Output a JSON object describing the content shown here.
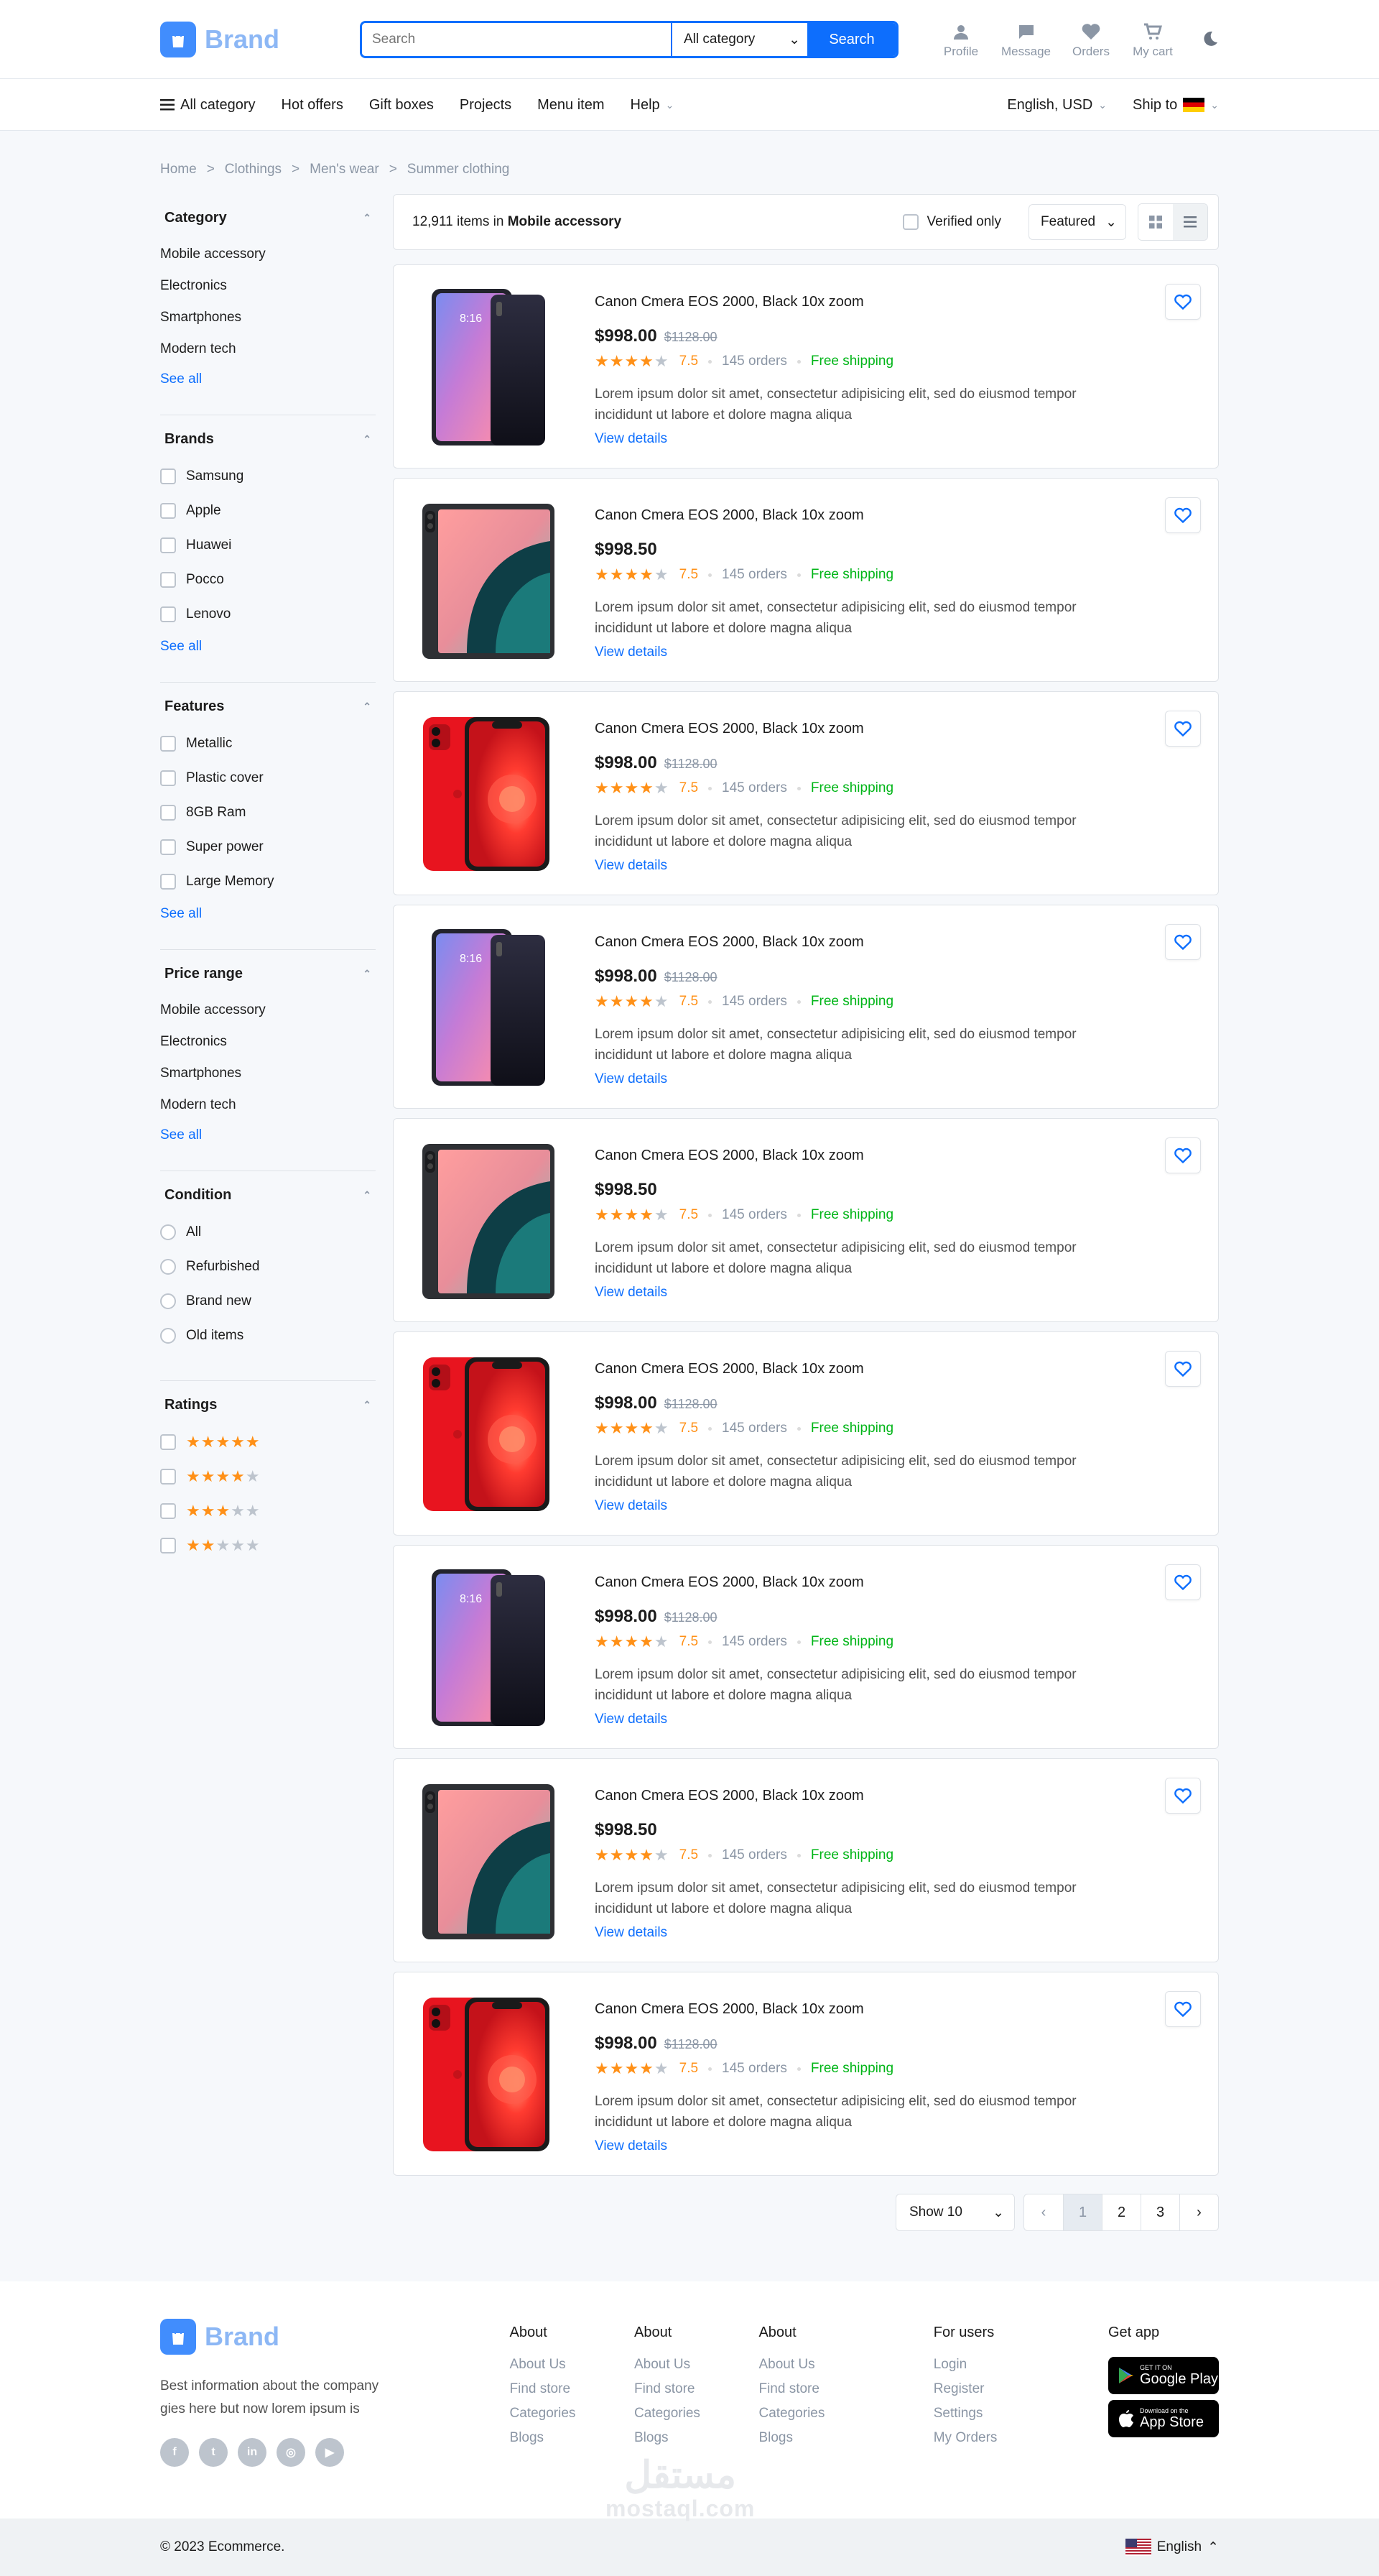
{
  "header": {
    "brand": "Brand",
    "search_placeholder": "Search",
    "category": "All category",
    "search_button": "Search",
    "actions": [
      {
        "label": "Profile",
        "icon": "user-icon"
      },
      {
        "label": "Message",
        "icon": "message-icon"
      },
      {
        "label": "Orders",
        "icon": "heart-icon"
      },
      {
        "label": "My cart",
        "icon": "cart-icon"
      }
    ]
  },
  "nav": {
    "all_category": "All category",
    "items": [
      "Hot offers",
      "Gift boxes",
      "Projects",
      "Menu item"
    ],
    "help": "Help",
    "lang": "English, USD",
    "ship_to": "Ship to"
  },
  "breadcrumb": [
    "Home",
    "Clothings",
    "Men's wear",
    "Summer clothing"
  ],
  "filters": {
    "category": {
      "title": "Category",
      "items": [
        "Mobile accessory",
        "Electronics",
        "Smartphones",
        "Modern tech"
      ],
      "see_all": "See all"
    },
    "brands": {
      "title": "Brands",
      "items": [
        "Samsung",
        "Apple",
        "Huawei",
        "Pocco",
        "Lenovo"
      ],
      "see_all": "See all"
    },
    "features": {
      "title": "Features",
      "items": [
        "Metallic",
        "Plastic cover",
        "8GB Ram",
        "Super power",
        "Large Memory"
      ],
      "see_all": "See all"
    },
    "price_range": {
      "title": "Price range",
      "items": [
        "Mobile accessory",
        "Electronics",
        "Smartphones",
        "Modern tech"
      ],
      "see_all": "See all"
    },
    "condition": {
      "title": "Condition",
      "items": [
        "All",
        "Refurbished",
        "Brand new",
        "Old items"
      ]
    },
    "ratings": {
      "title": "Ratings",
      "levels": [
        5,
        4,
        3,
        2
      ]
    }
  },
  "toolbar": {
    "count_text": "12,911 items in",
    "count_category": "Mobile accessory",
    "verified_only": "Verified only",
    "sort": "Featured"
  },
  "product_common": {
    "title": "Canon Cmera EOS 2000, Black 10x zoom",
    "rating": "7.5",
    "orders": "145 orders",
    "shipping": "Free shipping",
    "description": "Lorem ipsum dolor sit amet, consectetur adipisicing elit, sed do eiusmod tempor incididunt ut labore et dolore magna aliqua",
    "view_details": "View details"
  },
  "products": [
    {
      "price": "$998.00",
      "old_price": "$1128.00",
      "image": "phone-gradient"
    },
    {
      "price": "$998.50",
      "old_price": "",
      "image": "tablet-dark"
    },
    {
      "price": "$998.00",
      "old_price": "$1128.00",
      "image": "iphone-red"
    },
    {
      "price": "$998.00",
      "old_price": "$1128.00",
      "image": "phone-gradient"
    },
    {
      "price": "$998.50",
      "old_price": "",
      "image": "tablet-dark"
    },
    {
      "price": "$998.00",
      "old_price": "$1128.00",
      "image": "iphone-red"
    },
    {
      "price": "$998.00",
      "old_price": "$1128.00",
      "image": "phone-gradient"
    },
    {
      "price": "$998.50",
      "old_price": "",
      "image": "tablet-dark"
    },
    {
      "price": "$998.00",
      "old_price": "$1128.00",
      "image": "iphone-red"
    }
  ],
  "pagination": {
    "show": "Show 10",
    "pages": [
      "1",
      "2",
      "3"
    ],
    "current": "1"
  },
  "footer": {
    "brand": "Brand",
    "about_text": "Best information about the company gies here but now lorem ipsum is",
    "columns": [
      {
        "title": "About",
        "links": [
          "About Us",
          "Find store",
          "Categories",
          "Blogs"
        ]
      },
      {
        "title": "About",
        "links": [
          "About Us",
          "Find store",
          "Categories",
          "Blogs"
        ]
      },
      {
        "title": "About",
        "links": [
          "About Us",
          "Find store",
          "Categories",
          "Blogs"
        ]
      },
      {
        "title": "For users",
        "links": [
          "Login",
          "Register",
          "Settings",
          "My Orders"
        ]
      }
    ],
    "get_app": "Get app",
    "google_small": "GET IT ON",
    "google_big": "Google Play",
    "apple_small": "Download on the",
    "apple_big": "App Store",
    "watermark_ar": "مستقل",
    "watermark_en": "mostaql.com",
    "copyright": "© 2023 Ecommerce.",
    "language": "English"
  },
  "colors": {
    "primary": "#0d6efd",
    "star": "#ff9017",
    "shipping": "#00b517",
    "muted": "#8b96a5"
  }
}
